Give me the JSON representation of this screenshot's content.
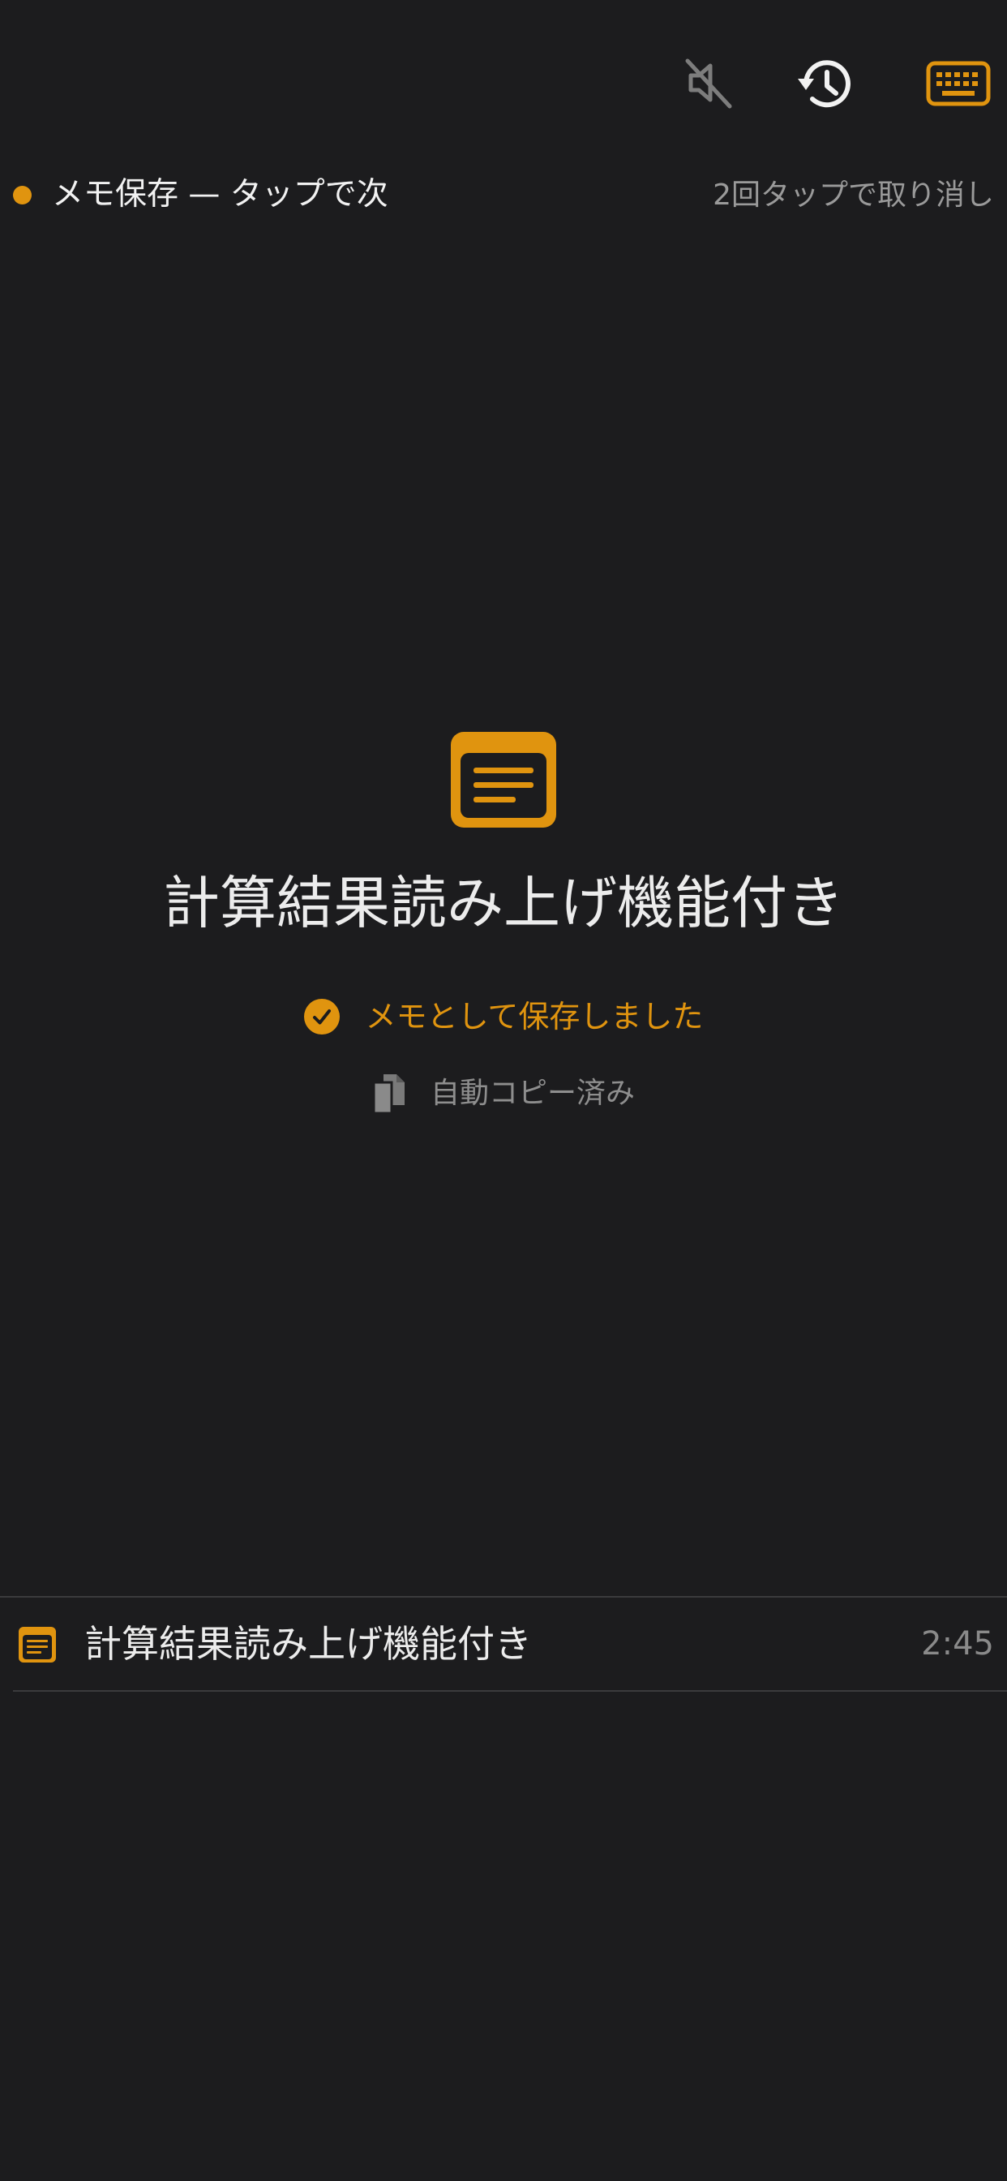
{
  "colors": {
    "background": "#1c1c1e",
    "accent": "#e0940f",
    "text_primary": "#f2f2f2",
    "text_secondary": "#9a9a9a",
    "divider": "#3b3b3d"
  },
  "toolbar": {
    "icons": [
      "speaker-muted-icon",
      "history-icon",
      "keyboard-icon"
    ]
  },
  "status": {
    "text": "メモ保存 — タップで次",
    "undo_hint": "2回タップで取り消し"
  },
  "result": {
    "icon": "note-icon",
    "title": "計算結果読み上げ機能付き",
    "saved_label": "メモとして保存しました",
    "copied_label": "自動コピー済み"
  },
  "history": {
    "items": [
      {
        "icon": "note-icon",
        "title": "計算結果読み上げ機能付き",
        "time": "2:45"
      }
    ]
  }
}
